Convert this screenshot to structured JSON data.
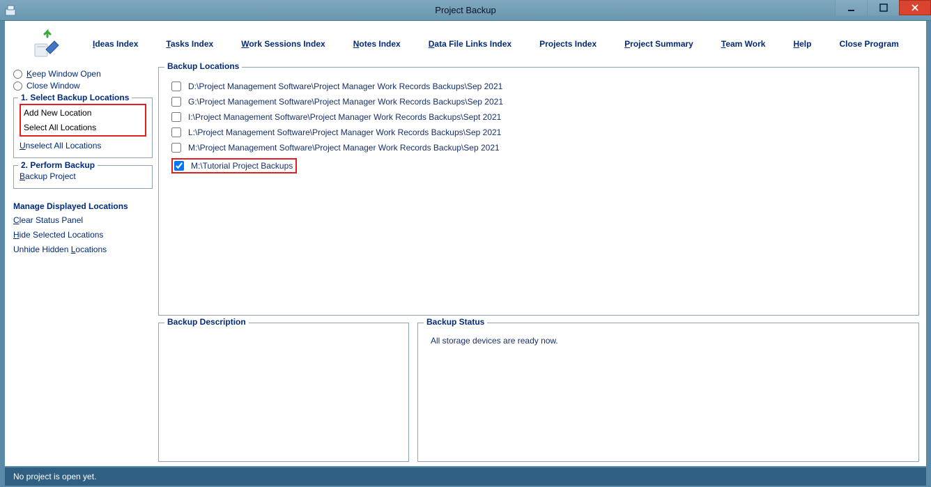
{
  "window": {
    "title": "Project Backup"
  },
  "menu": [
    {
      "u": "I",
      "label": "deas Index"
    },
    {
      "u": "T",
      "label": "asks Index"
    },
    {
      "u": "W",
      "label": "ork Sessions Index"
    },
    {
      "u": "N",
      "label": "otes Index"
    },
    {
      "u": "D",
      "label": "ata File Links Index"
    },
    {
      "u": "",
      "label": "Projects Index"
    },
    {
      "u": "P",
      "label": "roject Summary"
    },
    {
      "u": "T",
      "label": "eam Work"
    },
    {
      "u": "H",
      "label": "elp"
    },
    {
      "u": "",
      "label": "Close Program"
    }
  ],
  "sidebar": {
    "radios": {
      "keep": {
        "u": "K",
        "label": "eep Window Open"
      },
      "close": {
        "u": "",
        "label": "Close Window"
      }
    },
    "group1": {
      "legend": "1. Select Backup Locations",
      "add": {
        "u": "A",
        "label": "dd New Location"
      },
      "selectAll": {
        "u": "S",
        "label": "elect All Locations"
      },
      "unselect": {
        "u": "U",
        "label": "nselect All Locations"
      }
    },
    "group2": {
      "legend": "2. Perform Backup",
      "backup": {
        "u": "B",
        "label": "ackup Project"
      }
    },
    "manage": {
      "legend": "Manage Displayed Locations",
      "clear": {
        "u": "C",
        "label": "lear Status Panel"
      },
      "hide": {
        "u": "H",
        "label": "ide Selected Locations"
      },
      "unhide": {
        "pre": "Unhide Hidden ",
        "u": "L",
        "label": "ocations"
      }
    }
  },
  "locations": {
    "legend": "Backup Locations",
    "items": [
      {
        "checked": false,
        "path": "D:\\Project Management Software\\Project Manager Work Records Backups\\Sep 2021"
      },
      {
        "checked": false,
        "path": "G:\\Project Management Software\\Project Manager Work Records Backups\\Sep 2021"
      },
      {
        "checked": false,
        "path": "I:\\Project Management Software\\Project Manager Work Records Backups\\Sept 2021"
      },
      {
        "checked": false,
        "path": "L:\\Project Management Software\\Project Manager Work Records Backups\\Sep 2021"
      },
      {
        "checked": false,
        "path": "M:\\Project Management Software\\Project Manager Work Records Backup\\Sep 2021"
      },
      {
        "checked": true,
        "path": "M:\\Tutorial Project Backups",
        "highlight": true
      }
    ]
  },
  "description": {
    "legend": "Backup Description"
  },
  "status": {
    "legend": "Backup Status",
    "text": "All storage devices are ready now."
  },
  "statusbar": "No project is open yet."
}
